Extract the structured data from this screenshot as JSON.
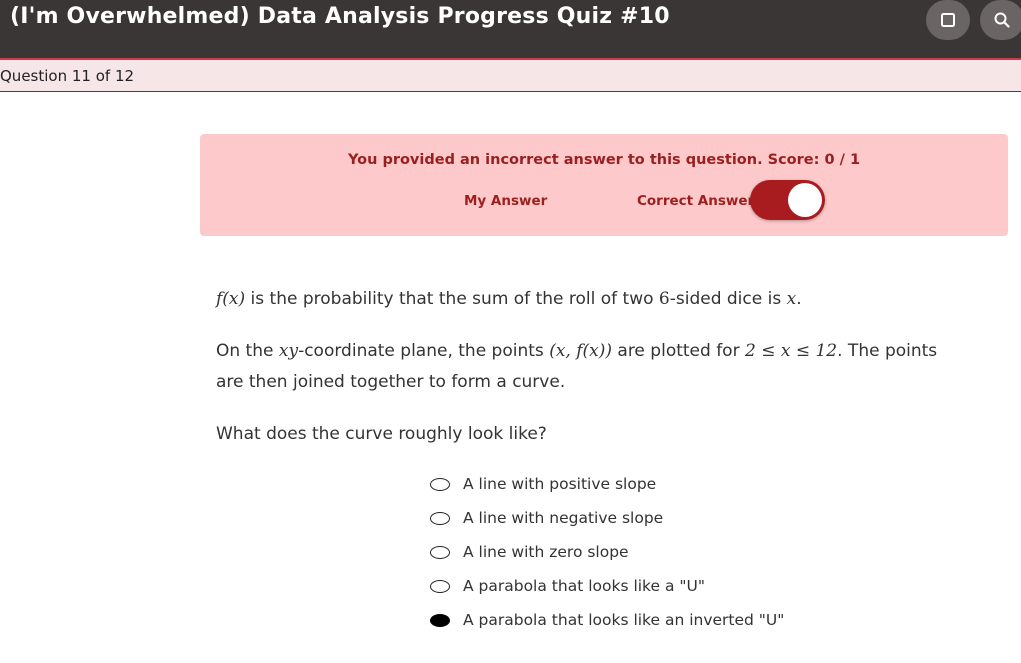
{
  "header": {
    "title": "(I'm Overwhelmed) Data Analysis Progress Quiz #10",
    "icons": [
      "square-icon",
      "search-icon"
    ]
  },
  "progress": {
    "label": "Question 11 of 12"
  },
  "feedback": {
    "message": "You provided an incorrect answer to this question. Score: 0 / 1",
    "left_label": "My Answer",
    "right_label": "Correct Answer",
    "toggle_state": "on"
  },
  "question": {
    "p1_text": " is the probability that the sum of the roll of two ",
    "p1_fx": "f(x)",
    "p1_six": "6",
    "p1_tail": "-sided dice is ",
    "p1_x": "x",
    "p2_a": "On the ",
    "p2_xy": "xy",
    "p2_b": "-coordinate plane, the points ",
    "p2_pts": "(x, f(x))",
    "p2_c": " are plotted for ",
    "p2_range": "2 ≤ x ≤ 12",
    "p2_d": ". The points",
    "p2_line2": "are then joined together to form a curve.",
    "p3": "What does the curve roughly look like?"
  },
  "choices": [
    {
      "label": "A line with positive slope",
      "selected": false
    },
    {
      "label": "A line with negative slope",
      "selected": false
    },
    {
      "label": "A line with zero slope",
      "selected": false
    },
    {
      "label": "A parabola that looks like a \"U\"",
      "selected": false
    },
    {
      "label": "A parabola that looks like an inverted \"U\"",
      "selected": true
    }
  ],
  "colors": {
    "accent": "#a81c1f",
    "alert_bg": "#fdc9ca",
    "header_bg": "#3a3635"
  }
}
